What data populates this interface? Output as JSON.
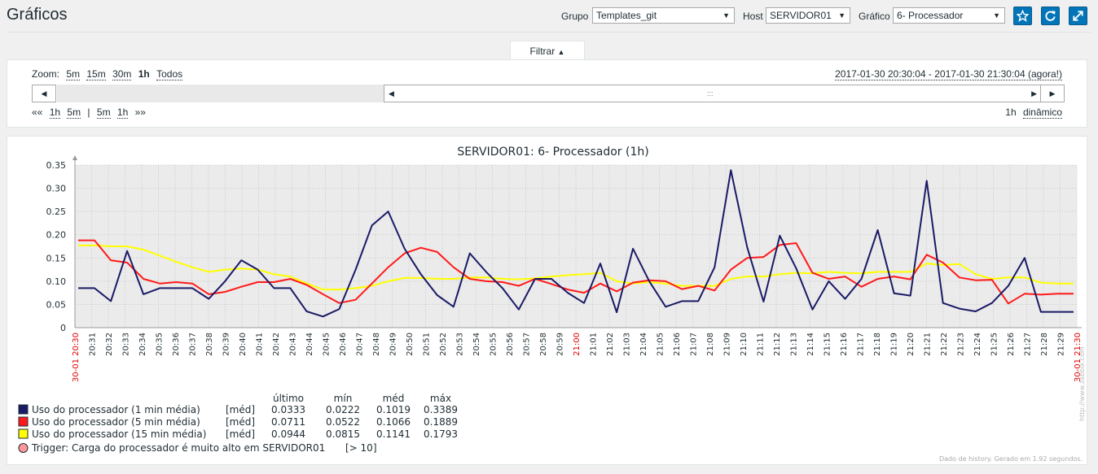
{
  "page": {
    "title": "Gráficos"
  },
  "filters": {
    "group_label": "Grupo",
    "group_value": "Templates_git",
    "host_label": "Host",
    "host_value": "SERVIDOR01",
    "graph_label": "Gráfico",
    "graph_value": "6- Processador"
  },
  "icons": [
    "star-icon",
    "refresh-icon",
    "fullscreen-icon"
  ],
  "filter_tab": {
    "label": "Filtrar"
  },
  "zoom": {
    "label": "Zoom:",
    "options": [
      "5m",
      "15m",
      "30m",
      "1h",
      "Todos"
    ],
    "active": "1h"
  },
  "period": {
    "text": "2017-01-30 20:30:04 - 2017-01-30 21:30:04 (agora!)"
  },
  "nav": {
    "back_arrows": "««",
    "back": [
      "1h",
      "5m"
    ],
    "separator": "|",
    "forward": [
      "5m",
      "1h"
    ],
    "forward_arrows": "»»",
    "period_size": "1h",
    "mode": "dinâmico"
  },
  "chart_data": {
    "type": "line",
    "title": "SERVIDOR01: 6- Processador (1h)",
    "ylim": [
      0,
      0.35
    ],
    "yticks": [
      "0",
      "0.05",
      "0.10",
      "0.15",
      "0.20",
      "0.25",
      "0.30",
      "0.35"
    ],
    "x_start_label": "30-01 20:30",
    "x_end_label": "30-01 21:30",
    "x_labels": [
      "20:31",
      "20:32",
      "20:33",
      "20:34",
      "20:35",
      "20:36",
      "20:37",
      "20:38",
      "20:39",
      "20:40",
      "20:41",
      "20:42",
      "20:43",
      "20:44",
      "20:45",
      "20:46",
      "20:47",
      "20:48",
      "20:49",
      "20:50",
      "20:51",
      "20:52",
      "20:53",
      "20:54",
      "20:55",
      "20:56",
      "20:57",
      "20:58",
      "20:59",
      "21:00",
      "21:01",
      "21:02",
      "21:03",
      "21:04",
      "21:05",
      "21:06",
      "21:07",
      "21:08",
      "21:09",
      "21:10",
      "21:11",
      "21:12",
      "21:13",
      "21:14",
      "21:15",
      "21:16",
      "21:17",
      "21:18",
      "21:19",
      "21:20",
      "21:21",
      "21:22",
      "21:23",
      "21:24",
      "21:25",
      "21:26",
      "21:27",
      "21:28",
      "21:29"
    ],
    "x_highlight": "21:00",
    "grid": true,
    "series": [
      {
        "name": "Uso do processador (1 min média)",
        "color": "#1a1a66",
        "values": [
          0.085,
          0.085,
          0.057,
          0.165,
          0.072,
          0.085,
          0.085,
          0.085,
          0.062,
          0.1,
          0.145,
          0.125,
          0.085,
          0.085,
          0.035,
          0.024,
          0.04,
          0.125,
          0.22,
          0.25,
          0.17,
          0.115,
          0.07,
          0.045,
          0.16,
          0.12,
          0.085,
          0.039,
          0.105,
          0.105,
          0.075,
          0.053,
          0.138,
          0.033,
          0.17,
          0.1,
          0.045,
          0.057,
          0.057,
          0.13,
          0.339,
          0.173,
          0.056,
          0.198,
          0.128,
          0.039,
          0.1,
          0.062,
          0.105,
          0.21,
          0.074,
          0.069,
          0.316,
          0.053,
          0.041,
          0.035,
          0.053,
          0.09,
          0.15,
          0.034,
          0.034,
          0.034
        ]
      },
      {
        "name": "Uso do processador (5 min média)",
        "color": "#ff1a1a",
        "values": [
          0.188,
          0.188,
          0.145,
          0.14,
          0.105,
          0.095,
          0.098,
          0.095,
          0.072,
          0.077,
          0.088,
          0.098,
          0.098,
          0.105,
          0.092,
          0.072,
          0.053,
          0.06,
          0.095,
          0.13,
          0.16,
          0.172,
          0.163,
          0.13,
          0.105,
          0.1,
          0.098,
          0.09,
          0.105,
          0.094,
          0.082,
          0.075,
          0.095,
          0.078,
          0.097,
          0.102,
          0.1,
          0.083,
          0.09,
          0.08,
          0.125,
          0.15,
          0.152,
          0.178,
          0.182,
          0.118,
          0.105,
          0.11,
          0.088,
          0.105,
          0.11,
          0.104,
          0.157,
          0.14,
          0.108,
          0.102,
          0.103,
          0.052,
          0.073,
          0.071,
          0.073,
          0.073
        ]
      },
      {
        "name": "Uso do processador (15 min média)",
        "color": "#ffff00",
        "values": [
          0.177,
          0.177,
          0.175,
          0.175,
          0.168,
          0.155,
          0.142,
          0.13,
          0.12,
          0.125,
          0.127,
          0.125,
          0.115,
          0.11,
          0.095,
          0.082,
          0.082,
          0.085,
          0.09,
          0.1,
          0.107,
          0.107,
          0.105,
          0.105,
          0.108,
          0.108,
          0.105,
          0.104,
          0.106,
          0.11,
          0.113,
          0.115,
          0.118,
          0.1,
          0.095,
          0.098,
          0.095,
          0.09,
          0.09,
          0.09,
          0.105,
          0.11,
          0.11,
          0.115,
          0.118,
          0.117,
          0.12,
          0.118,
          0.117,
          0.12,
          0.12,
          0.12,
          0.138,
          0.135,
          0.137,
          0.115,
          0.105,
          0.108,
          0.108,
          0.097,
          0.095,
          0.095
        ]
      }
    ],
    "stats_headers": [
      "último",
      "mín",
      "méd",
      "máx"
    ],
    "legend": [
      {
        "name": "Uso do processador (1 min média)",
        "func": "[méd]",
        "last": "0.0333",
        "min": "0.0222",
        "avg": "0.1019",
        "max": "0.3389",
        "color": "#1a1a66"
      },
      {
        "name": "Uso do processador (5 min média)",
        "func": "[méd]",
        "last": "0.0711",
        "min": "0.0522",
        "avg": "0.1066",
        "max": "0.1889",
        "color": "#ff1a1a"
      },
      {
        "name": "Uso do processador (15 min média)",
        "func": "[méd]",
        "last": "0.0944",
        "min": "0.0815",
        "avg": "0.1141",
        "max": "0.1793",
        "color": "#ffff00"
      }
    ],
    "trigger": {
      "text": "Trigger: Carga do processador é muito alto em SERVIDOR01",
      "condition": "[> 10]",
      "color": "#ff9999"
    },
    "footer_note": "Dado de history. Gerado em 1.92 segundos.",
    "watermark": "http://www.zabbix.com"
  }
}
